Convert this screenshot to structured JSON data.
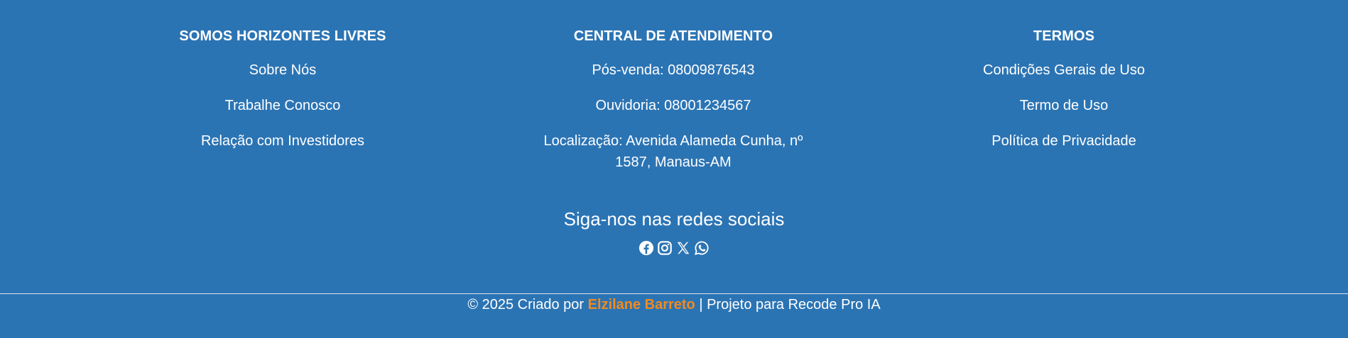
{
  "footer": {
    "columns": [
      {
        "title": "SOMOS HORIZONTES LIVRES",
        "links": [
          "Sobre Nós",
          "Trabalhe Conosco",
          "Relação com Investidores"
        ]
      },
      {
        "title": "CENTRAL DE ATENDIMENTO",
        "links": [
          "Pós-venda: 08009876543",
          "Ouvidoria: 08001234567",
          "Localização: Avenida Alameda Cunha, nº 1587, Manaus-AM"
        ]
      },
      {
        "title": "TERMOS",
        "links": [
          "Condições Gerais de Uso",
          "Termo de Uso",
          "Política de Privacidade"
        ]
      }
    ],
    "social": {
      "heading": "Siga-nos nas redes sociais",
      "icons": [
        "facebook-icon",
        "instagram-icon",
        "x-icon",
        "whatsapp-icon"
      ]
    },
    "copyright": {
      "prefix": "© 2025 Criado por",
      "author": "Elzilane Barreto",
      "suffix": "| Projeto para Recode Pro IA"
    }
  },
  "colors": {
    "background": "#2b74b4",
    "text": "#ffffff",
    "accent": "#f28a1e"
  }
}
